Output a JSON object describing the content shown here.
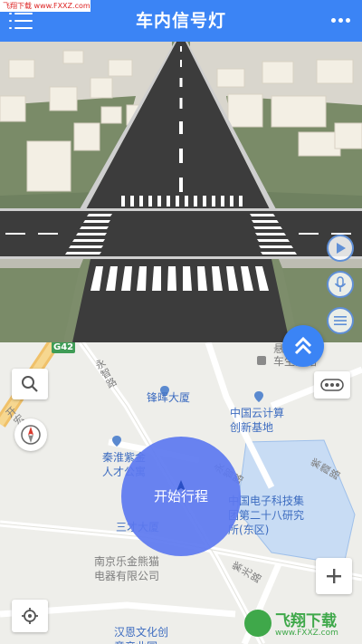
{
  "watermark_top": "飞翔下载 www.FXXZ.com",
  "header": {
    "title": "车内信号灯",
    "menu_icon": "hamburger-menu-icon",
    "more_icon": "more-dots-icon"
  },
  "scene_controls": {
    "play_icon": "play-icon",
    "mic_icon": "microphone-icon",
    "list_icon": "list-icon",
    "expand_icon": "double-chevron-up-icon"
  },
  "map": {
    "road_badge": "G42",
    "labels": {
      "bus_stop": "悬\n车生活馆",
      "road_yongzhi": "永\n智\n路",
      "fenghui": "锋晖大厦",
      "cloud": "中国云计算\n创新基地",
      "qinhuai": "秦淮紫金\n人才公寓",
      "yongzhi2": "永\n智\n路",
      "zixia": "紫\n霞\n路",
      "cetc": "中国电子科技集\n团第二十八研究\n所(东区)",
      "sancai": "三才大厦",
      "nanjing_lejin": "南京乐金熊猫\n电器有限公司",
      "ziguang": "紫\n光\n路",
      "hanen": "汉恩文化创\n意产业园",
      "kaiyuan": "开\n宏\n路"
    },
    "start_label": "开始行程",
    "search_icon": "search-icon",
    "compass_icon": "compass-icon",
    "poi_button_icon": "poi-dots-icon",
    "zoom_in_icon": "plus-icon",
    "locate_icon": "locate-icon"
  },
  "watermark_bottom": {
    "brand": "飞翔下载",
    "site": "www.FXXZ.com"
  },
  "colors": {
    "header": "#3b84f5",
    "accent": "#3b84f5",
    "start_circle": "#5c78f0",
    "road": "#3a3a3a",
    "grass": "#78896a"
  }
}
